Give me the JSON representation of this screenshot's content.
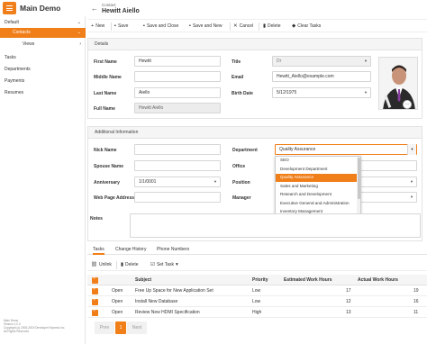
{
  "app": {
    "title": "Main Demo"
  },
  "sidebar": {
    "items": [
      {
        "label": "Default",
        "chev": "⌄"
      },
      {
        "label": "Contacts",
        "chev": "⌄"
      },
      {
        "label": "Views",
        "chev": "›"
      },
      {
        "label": "Tasks"
      },
      {
        "label": "Departments"
      },
      {
        "label": "Payments"
      },
      {
        "label": "Resumes"
      }
    ],
    "footer": [
      "Main Demo",
      "Version 1.0.0",
      "Copyright (c) 2006-2019 Developer Express Inc.",
      "All Rights Reserved"
    ]
  },
  "header": {
    "breadcrumb": "Contact",
    "title": "Hewitt Aiello"
  },
  "toolbar": {
    "new": "New",
    "save": "Save",
    "save_close": "Save and Close",
    "save_new": "Save and New",
    "cancel": "Cancel",
    "delete": "Delete",
    "clear_tasks": "Clear Tasks"
  },
  "details": {
    "heading": "Details",
    "first_name_label": "First Name",
    "first_name": "Hewitt",
    "middle_name_label": "Middle Name",
    "middle_name": "",
    "last_name_label": "Last Name",
    "last_name": "Aiello",
    "full_name_label": "Full Name",
    "full_name": "Hewitt Aiello",
    "title_label": "Title",
    "title": "Dr",
    "email_label": "Email",
    "email": "Hewitt_Aiello@example.com",
    "birth_date_label": "Birth Date",
    "birth_date": "5/12/1975"
  },
  "additional": {
    "heading": "Additional Information",
    "nick_name_label": "Nick Name",
    "nick_name": "",
    "spouse_name_label": "Spouse Name",
    "spouse_name": "",
    "anniversary_label": "Anniversary",
    "anniversary": "1/1/0001",
    "web_page_label": "Web Page Address",
    "web_page": "",
    "department_label": "Department",
    "department": "Quality Assurance",
    "office_label": "Office",
    "position_label": "Position",
    "manager_label": "Manager"
  },
  "department_options": [
    "SEO",
    "Development Department",
    "Quality Assurance",
    "Sales and Marketing",
    "Research and Development",
    "Executive General and Administration",
    "Inventory Management"
  ],
  "notes_label": "Notes",
  "tabs": [
    "Tasks",
    "Change History",
    "Phone Numbers"
  ],
  "grid_toolbar": {
    "unlink": "Unlink",
    "delete": "Delete",
    "set_task": "Set Task"
  },
  "grid": {
    "columns": [
      "Subject",
      "Priority",
      "Estimated Work Hours",
      "Actual Work Hours"
    ],
    "rows": [
      {
        "status": "Open",
        "subject": "Free Up Space for New Application Set",
        "priority": "Low",
        "est": "17",
        "act": "19"
      },
      {
        "status": "Open",
        "subject": "Install New Database",
        "priority": "Low",
        "est": "12",
        "act": "16"
      },
      {
        "status": "Open",
        "subject": "Review New HDMI Specification",
        "priority": "High",
        "est": "13",
        "act": "11"
      }
    ]
  },
  "pager": {
    "prev": "Prev",
    "page": "1",
    "next": "Next"
  },
  "colors": {
    "accent": "#f07e19"
  }
}
